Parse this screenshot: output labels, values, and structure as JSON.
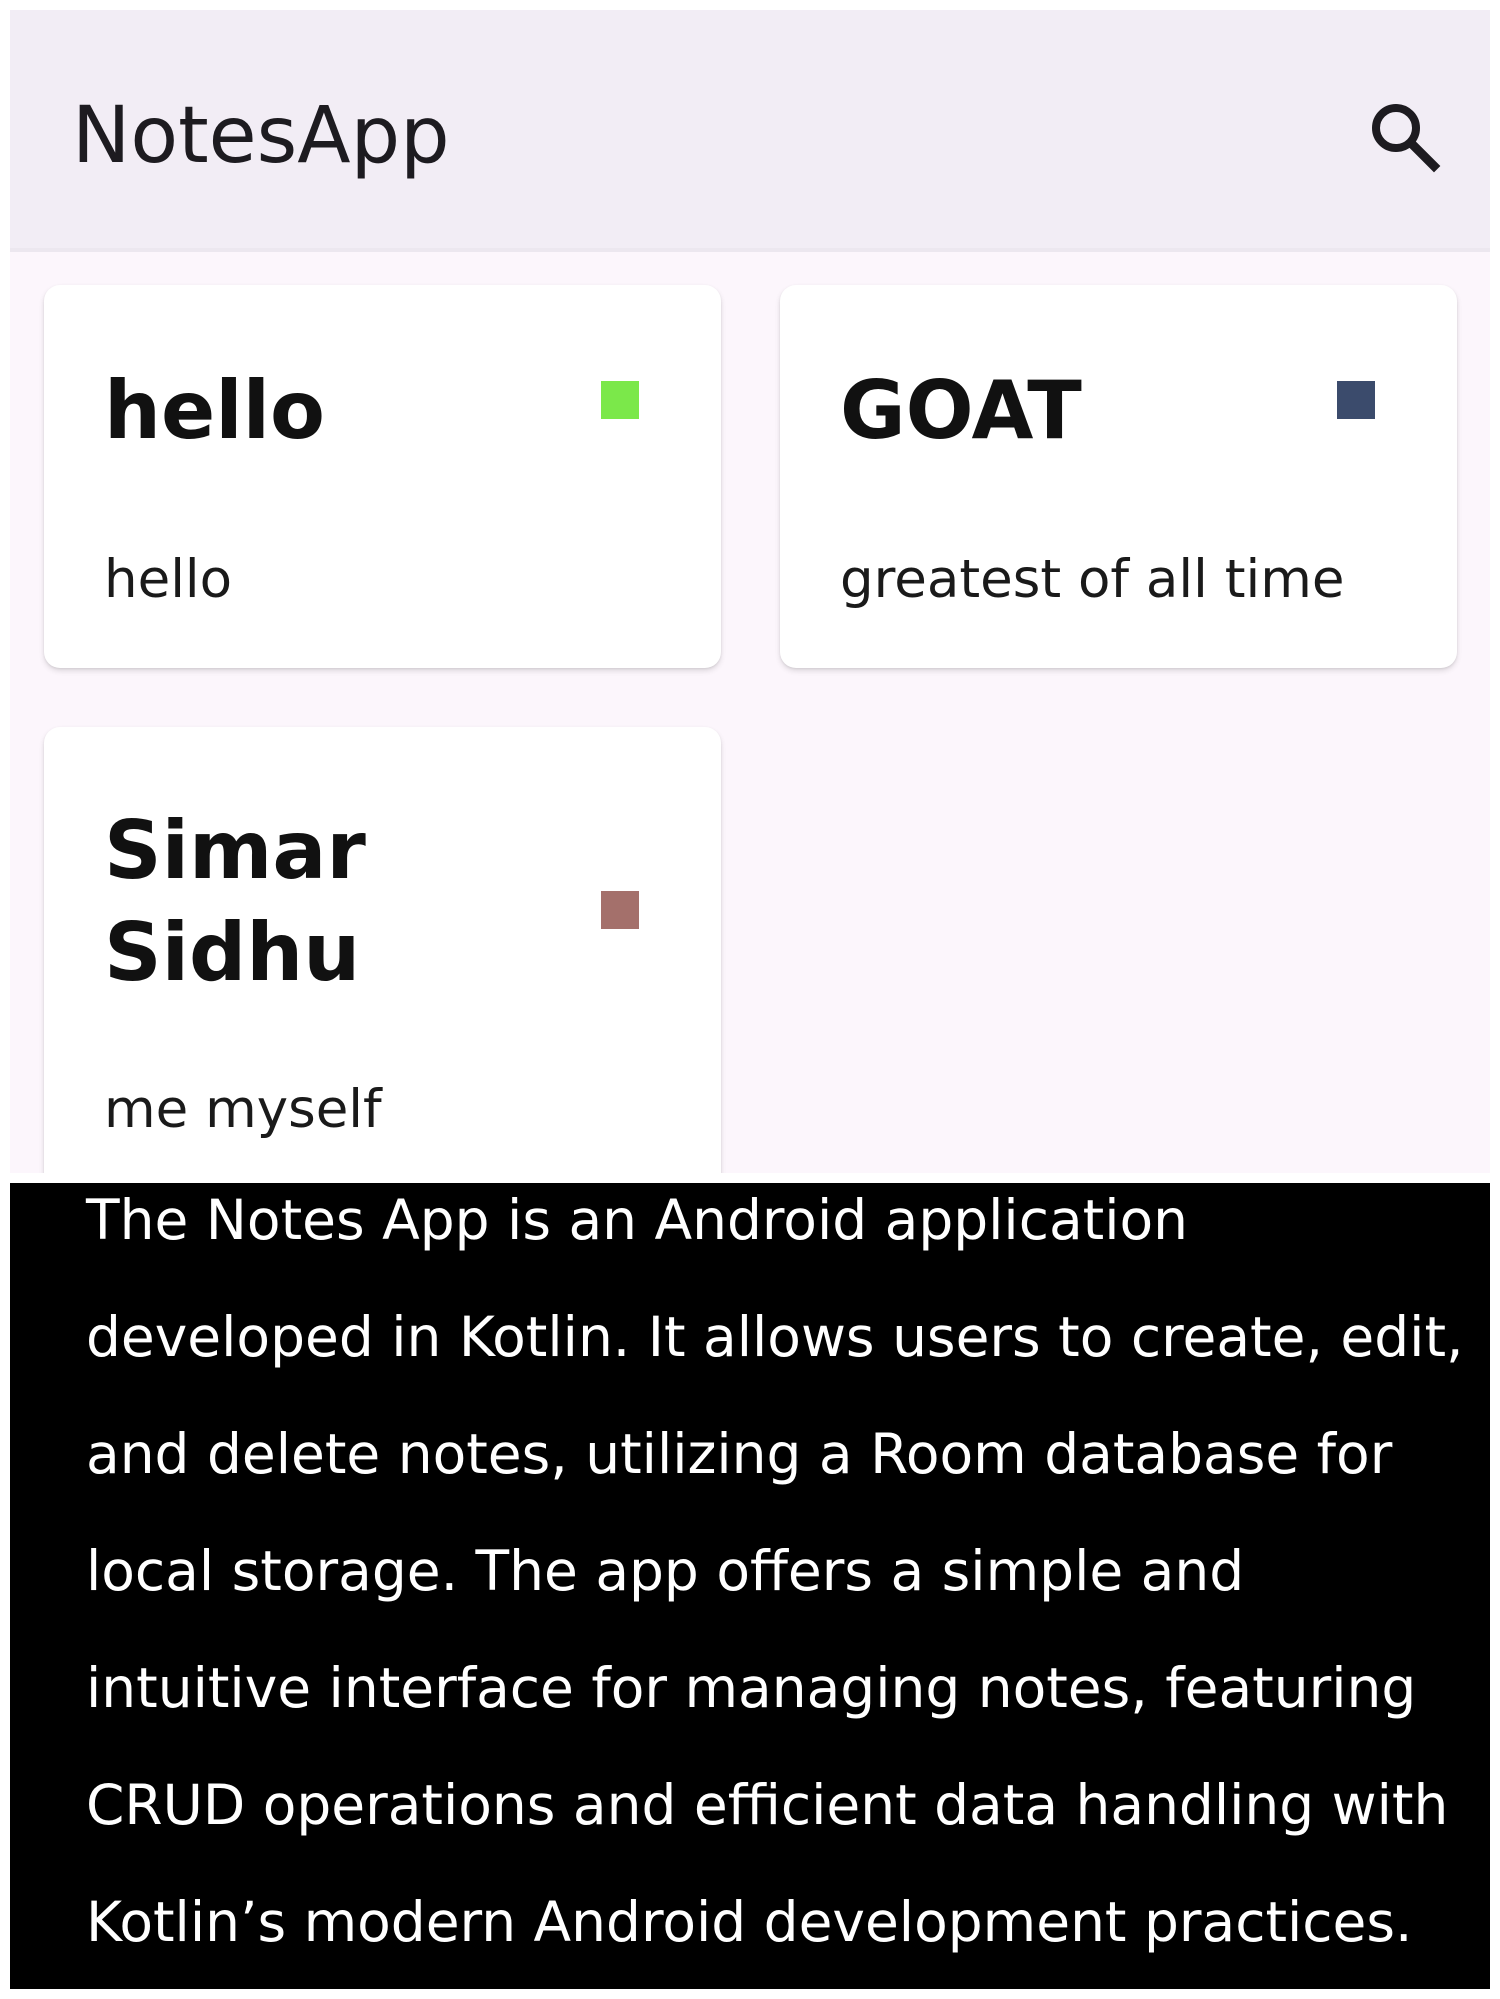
{
  "app_bar": {
    "title": "NotesApp",
    "search_icon": "search-icon",
    "background": "#f2edf5"
  },
  "notes": [
    {
      "title": "hello",
      "body": "hello",
      "color": "#7be84a"
    },
    {
      "title": "GOAT",
      "body": "greatest of all time",
      "color": "#3b4b6c"
    },
    {
      "title_lines": [
        "Simar",
        "Sidhu"
      ],
      "body": "me myself",
      "color": "#a4706b"
    }
  ],
  "description": {
    "lines": [
      "The Notes App is an Android application",
      "developed in Kotlin. It allows users to create, edit,",
      "and delete notes, utilizing a Room database for",
      "local storage. The app offers a simple and",
      "intuitive interface for managing notes, featuring",
      "CRUD operations and efficient data handling with",
      "Kotlin’s modern Android development practices."
    ],
    "background": "#000000",
    "text_color": "#ffffff"
  }
}
